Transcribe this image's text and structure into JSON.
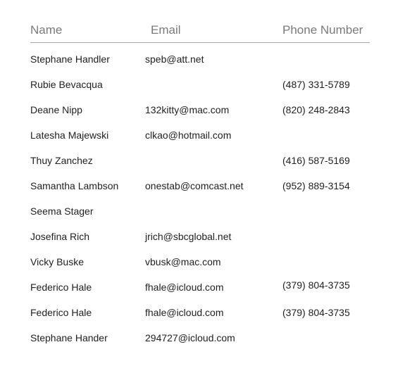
{
  "table": {
    "columns": {
      "name": "Name",
      "email": "Email",
      "phone": "Phone Number"
    },
    "rows": [
      {
        "name": "Stephane Handler",
        "email": "speb@att.net",
        "phone": ""
      },
      {
        "name": "Rubie Bevacqua",
        "email": "",
        "phone": "(487) 331-5789"
      },
      {
        "name": "Deane Nipp",
        "email": "132kitty@mac.com",
        "phone": "(820) 248-2843"
      },
      {
        "name": "Latesha Majewski",
        "email": "clkao@hotmail.com",
        "phone": ""
      },
      {
        "name": "Thuy Zanchez",
        "email": "",
        "phone": "(416) 587-5169"
      },
      {
        "name": "Samantha Lambson",
        "email": "onestab@comcast.net",
        "phone": "(952) 889-3154"
      },
      {
        "name": "Seema Stager",
        "email": "",
        "phone": ""
      },
      {
        "name": "Josefina Rich",
        "email": "jrich@sbcglobal.net",
        "phone": ""
      },
      {
        "name": "Vicky Buske",
        "email": "vbusk@mac.com",
        "phone": ""
      },
      {
        "name": "Federico Hale",
        "email": "fhale@icloud.com",
        "phone": "(379) 804-3735"
      },
      {
        "name": "Federico Hale",
        "email": "fhale@icloud.com",
        "phone": "(379) 804-3735"
      },
      {
        "name": "Stephane Hander",
        "email": "294727@icloud.com",
        "phone": ""
      }
    ]
  }
}
